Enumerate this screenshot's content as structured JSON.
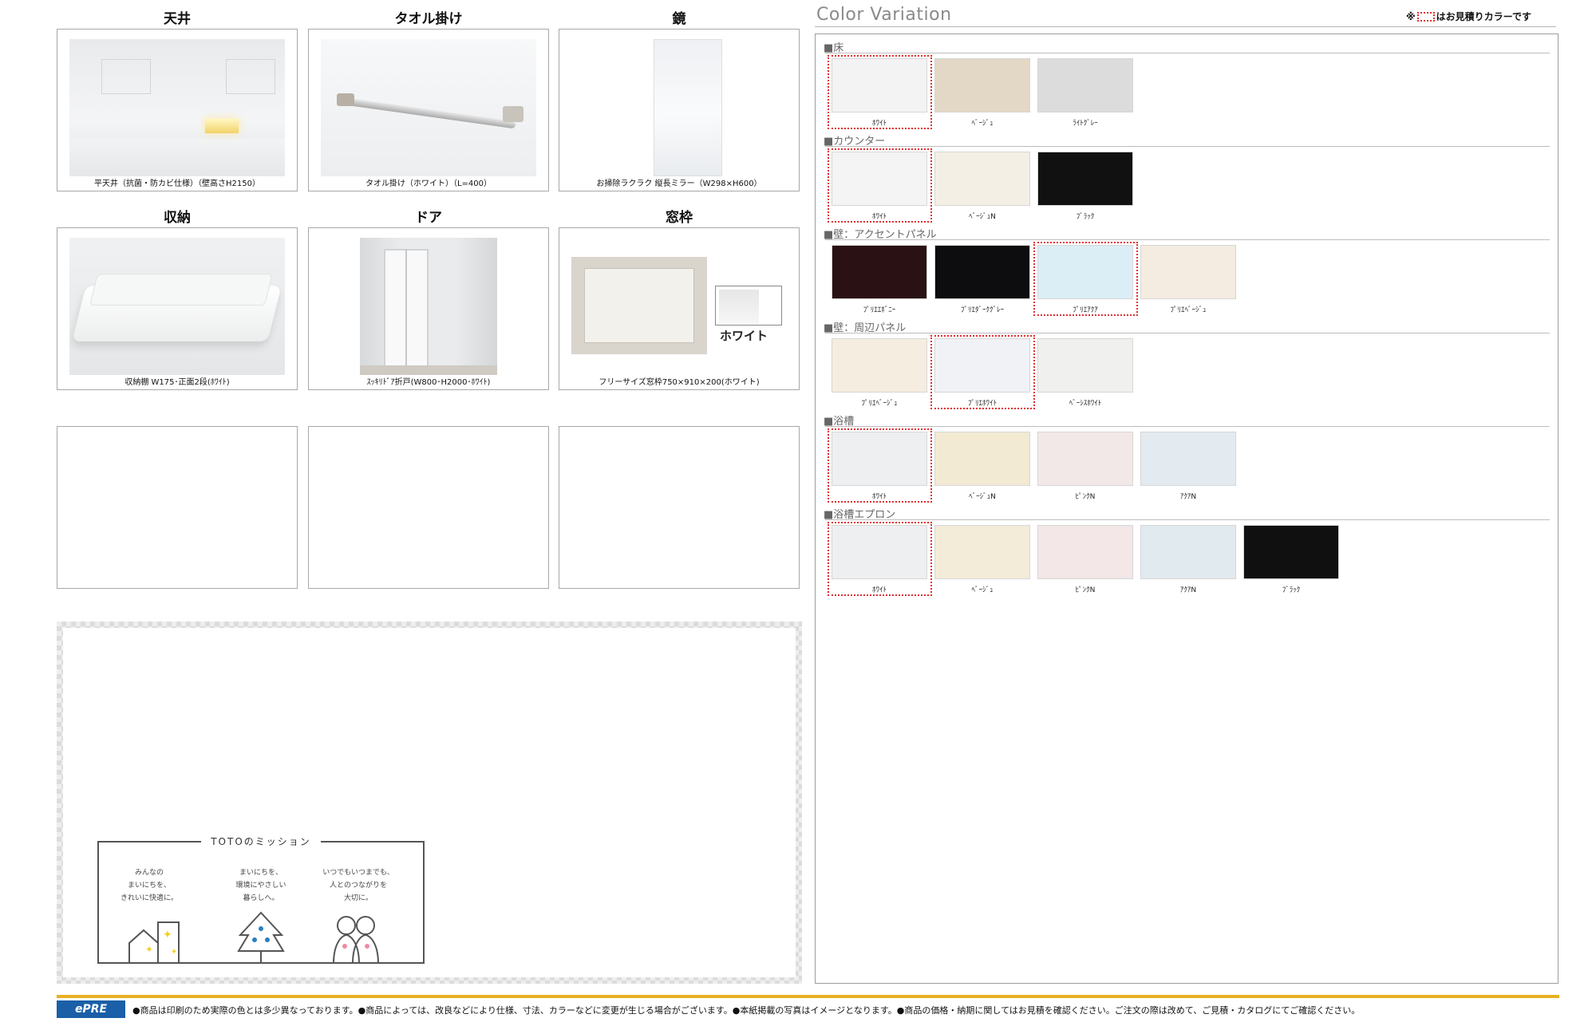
{
  "products": [
    {
      "title": "天井",
      "caption": "平天井（抗菌・防カビ仕様）（壁高さH2150）"
    },
    {
      "title": "タオル掛け",
      "caption": "タオル掛け（ホワイト）（L=400）"
    },
    {
      "title": "鏡",
      "caption": "お掃除ラクラク 縦長ミラー（W298×H600）"
    },
    {
      "title": "収納",
      "caption": "収納棚 W175･正面2段(ﾎﾜｲﾄ)"
    },
    {
      "title": "ドア",
      "caption": "ｽｯｷﾘﾄﾞｱ折戸(W800･H2000･ﾎﾜｲﾄ)"
    },
    {
      "title": "窓枠",
      "caption": "フリーサイズ窓枠750×910×200(ホワイト)",
      "swatch_label": "ホワイト"
    }
  ],
  "mission": {
    "title": "TOTOのミッション",
    "columns": [
      [
        "みんなの",
        "まいにちを、",
        "きれいに快適に。"
      ],
      [
        "まいにちを、",
        "環境にやさしい",
        "暮らしへ。"
      ],
      [
        "いつでもいつまでも、",
        "人とのつながりを",
        "大切に。"
      ]
    ]
  },
  "color_variation": {
    "title": "Color Variation",
    "note_prefix": "※",
    "note_suffix": "はお見積りカラーです",
    "sections": [
      {
        "label": "■床",
        "swatches": [
          {
            "name": "ﾎﾜｲﾄ",
            "color": "#f3f3f3",
            "selected": true
          },
          {
            "name": "ﾍﾞｰｼﾞｭ",
            "color": "#e3d8c6",
            "selected": false
          },
          {
            "name": "ﾗｲﾄｸﾞﾚｰ",
            "color": "#dcdcdc",
            "selected": false
          }
        ]
      },
      {
        "label": "■カウンター",
        "swatches": [
          {
            "name": "ﾎﾜｲﾄ",
            "color": "#f4f4f4",
            "selected": true
          },
          {
            "name": "ﾍﾞｰｼﾞｭN",
            "color": "#f3efe5",
            "selected": false
          },
          {
            "name": "ﾌﾞﾗｯｸ",
            "color": "#111111",
            "selected": false
          }
        ]
      },
      {
        "label": "■壁：アクセントパネル",
        "swatches": [
          {
            "name": "ﾌﾟﾘｴｴﾎﾞﾆｰ",
            "color": "#2a1214",
            "selected": false
          },
          {
            "name": "ﾌﾟﾘｴﾀﾞｰｸｸﾞﾚｰ",
            "color": "#0d0d0f",
            "selected": false
          },
          {
            "name": "ﾌﾟﾘｴｱｸｱ",
            "color": "#dbeef6",
            "selected": true
          },
          {
            "name": "ﾌﾟﾘｴﾍﾞｰｼﾞｭ",
            "color": "#f4ece0",
            "selected": false
          }
        ]
      },
      {
        "label": "■壁：周辺パネル",
        "swatches": [
          {
            "name": "ﾌﾟﾘｴﾍﾞｰｼﾞｭ",
            "color": "#f5ede0",
            "selected": false
          },
          {
            "name": "ﾌﾟﾘｴﾎﾜｲﾄ",
            "color": "#f1f2f5",
            "selected": true
          },
          {
            "name": "ﾍﾞｰｼｽﾎﾜｲﾄ",
            "color": "#f0f0ee",
            "selected": false
          }
        ]
      },
      {
        "label": "■浴槽",
        "swatches": [
          {
            "name": "ﾎﾜｲﾄ",
            "color": "#eeeff1",
            "selected": true
          },
          {
            "name": "ﾍﾞｰｼﾞｭN",
            "color": "#f2ead3",
            "selected": false
          },
          {
            "name": "ﾋﾟﾝｸN",
            "color": "#f3e8e8",
            "selected": false
          },
          {
            "name": "ｱｸｱN",
            "color": "#e3ebf0",
            "selected": false
          }
        ]
      },
      {
        "label": "■浴槽エプロン",
        "swatches": [
          {
            "name": "ﾎﾜｲﾄ",
            "color": "#eeeff1",
            "selected": true
          },
          {
            "name": "ﾍﾞｰｼﾞｭ",
            "color": "#f3ecd8",
            "selected": false
          },
          {
            "name": "ﾋﾟﾝｸN",
            "color": "#f3e7e8",
            "selected": false
          },
          {
            "name": "ｱｸｱN",
            "color": "#e1eaef",
            "selected": false
          },
          {
            "name": "ﾌﾞﾗｯｸ",
            "color": "#101010",
            "selected": false
          }
        ]
      }
    ]
  },
  "footer": {
    "logo": "ePRE",
    "text": "●商品は印刷のため実際の色とは多少異なっております。●商品によっては、改良などにより仕様、寸法、カラーなどに変更が生じる場合がございます。●本紙掲載の写真はイメージとなります。●商品の価格・納期に関してはお見積を確認ください。ご注文の際は改めて、ご見積・カタログにてご確認ください。"
  },
  "colors": {
    "accent_yellow": "#e8b023",
    "select_red": "#e0302f",
    "logo_blue": "#1a5fa8"
  }
}
